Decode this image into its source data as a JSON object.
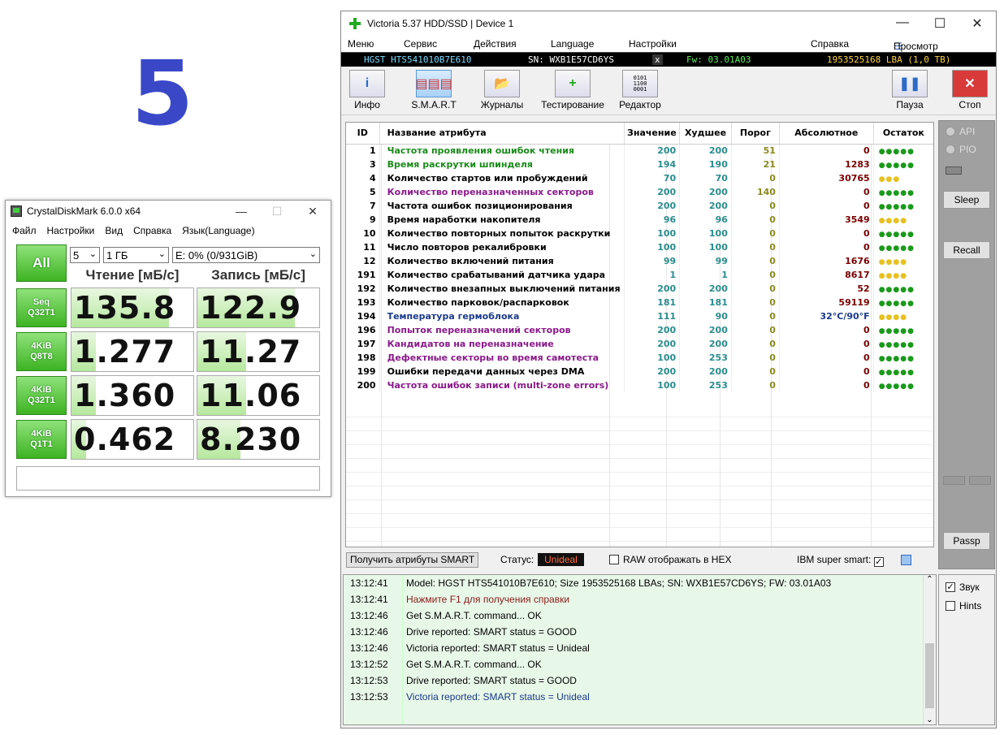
{
  "big_number": "5",
  "cdm": {
    "title": "CrystalDiskMark 6.0.0 x64",
    "menu": [
      "Файл",
      "Настройки",
      "Вид",
      "Справка",
      "Язык(Language)"
    ],
    "all_label": "All",
    "count_value": "5",
    "size_value": "1 ГБ",
    "drive_value": "E: 0% (0/931GiB)",
    "read_header": "Чтение [мБ/с]",
    "write_header": "Запись [мБ/с]",
    "tests": [
      {
        "line1": "Seq",
        "line2": "Q32T1",
        "read": "135.8",
        "write": "122.9",
        "read_fill": 0.8,
        "write_fill": 0.8
      },
      {
        "line1": "4KiB",
        "line2": "Q8T8",
        "read": "1.277",
        "write": "11.27",
        "read_fill": 0.2,
        "write_fill": 0.4
      },
      {
        "line1": "4KiB",
        "line2": "Q32T1",
        "read": "1.360",
        "write": "11.06",
        "read_fill": 0.2,
        "write_fill": 0.4
      },
      {
        "line1": "4KiB",
        "line2": "Q1T1",
        "read": "0.462",
        "write": "8.230",
        "read_fill": 0.12,
        "write_fill": 0.35
      }
    ]
  },
  "victoria": {
    "title": "Victoria 5.37 HDD/SSD | Device 1",
    "menu": {
      "menu": "Меню",
      "service": "Сервис",
      "actions": "Действия",
      "language": "Language",
      "settings": "Настройки",
      "help": "Справка",
      "buffer": "Просмотр буфера"
    },
    "device": {
      "model": "HGST HTS541010B7E610",
      "sn": "SN: WXB1E57CD6YS",
      "x": "x",
      "fw": "Fw: 03.01A03",
      "lba": "1953525168 LBA (1,0 TB)"
    },
    "tools": {
      "info": "Инфо",
      "smart": "S.M.A.R.T",
      "logs": "Журналы",
      "test": "Тестирование",
      "editor": "Редактор",
      "pause": "Пауза",
      "stop": "Стоп"
    },
    "table_headers": {
      "id": "ID",
      "name": "Название атрибута",
      "value": "Значение",
      "worst": "Худшее",
      "threshold": "Порог",
      "absolute": "Абсолютное",
      "remaining": "Остаток"
    },
    "attributes": [
      {
        "id": "1",
        "name": "Частота проявления ошибок чтения",
        "value": "200",
        "worst": "200",
        "thr": "51",
        "abs": "0",
        "color": "#1a8a1a",
        "dots": "green"
      },
      {
        "id": "3",
        "name": "Время раскрутки шпинделя",
        "value": "194",
        "worst": "190",
        "thr": "21",
        "abs": "1283",
        "color": "#1a8a1a",
        "dots": "green"
      },
      {
        "id": "4",
        "name": "Количество стартов или пробуждений",
        "value": "70",
        "worst": "70",
        "thr": "0",
        "abs": "30765",
        "color": "#000000",
        "dots": "yellow"
      },
      {
        "id": "5",
        "name": "Количество переназначенных секторов",
        "value": "200",
        "worst": "200",
        "thr": "140",
        "abs": "0",
        "color": "#8a1a8a",
        "dots": "green"
      },
      {
        "id": "7",
        "name": "Частота ошибок позиционирования",
        "value": "200",
        "worst": "200",
        "thr": "0",
        "abs": "0",
        "color": "#000000",
        "dots": "green"
      },
      {
        "id": "9",
        "name": "Время наработки накопителя",
        "value": "96",
        "worst": "96",
        "thr": "0",
        "abs": "3549",
        "color": "#000000",
        "dots": "yellow"
      },
      {
        "id": "10",
        "name": "Количество повторных попыток раскрутки",
        "value": "100",
        "worst": "100",
        "thr": "0",
        "abs": "0",
        "color": "#000000",
        "dots": "green"
      },
      {
        "id": "11",
        "name": "Число повторов рекалибровки",
        "value": "100",
        "worst": "100",
        "thr": "0",
        "abs": "0",
        "color": "#000000",
        "dots": "green"
      },
      {
        "id": "12",
        "name": "Количество включений питания",
        "value": "99",
        "worst": "99",
        "thr": "0",
        "abs": "1676",
        "color": "#000000",
        "dots": "yellow"
      },
      {
        "id": "191",
        "name": "Количество срабатываний датчика удара",
        "value": "1",
        "worst": "1",
        "thr": "0",
        "abs": "8617",
        "color": "#000000",
        "dots": "yellow"
      },
      {
        "id": "192",
        "name": "Количество внезапных выключений питания",
        "value": "200",
        "worst": "200",
        "thr": "0",
        "abs": "52",
        "color": "#000000",
        "dots": "green"
      },
      {
        "id": "193",
        "name": "Количество парковок/распарковок",
        "value": "181",
        "worst": "181",
        "thr": "0",
        "abs": "59119",
        "color": "#000000",
        "dots": "green"
      },
      {
        "id": "194",
        "name": "Температура гермоблока",
        "value": "111",
        "worst": "90",
        "thr": "0",
        "abs": "32°C/90°F",
        "color": "#1a3a8a",
        "dots": "yellow"
      },
      {
        "id": "196",
        "name": "Попыток переназначений секторов",
        "value": "200",
        "worst": "200",
        "thr": "0",
        "abs": "0",
        "color": "#8a1a8a",
        "dots": "green"
      },
      {
        "id": "197",
        "name": "Кандидатов на переназначение",
        "value": "200",
        "worst": "200",
        "thr": "0",
        "abs": "0",
        "color": "#8a1a8a",
        "dots": "green"
      },
      {
        "id": "198",
        "name": "Дефектные секторы во время самотеста",
        "value": "100",
        "worst": "253",
        "thr": "0",
        "abs": "0",
        "color": "#8a1a8a",
        "dots": "green"
      },
      {
        "id": "199",
        "name": "Ошибки передачи данных через DMA",
        "value": "200",
        "worst": "200",
        "thr": "0",
        "abs": "0",
        "color": "#000000",
        "dots": "green"
      },
      {
        "id": "200",
        "name": "Частота ошибок записи (multi-zone errors)",
        "value": "100",
        "worst": "253",
        "thr": "0",
        "abs": "0",
        "color": "#8a1a8a",
        "dots": "green"
      }
    ],
    "status_bar": {
      "get_smart": "Получить атрибуты SMART",
      "status_label": "Статус:",
      "status_value": "Unideal",
      "raw_hex": "RAW отображать в HEX",
      "ibm": "IBM super smart:"
    },
    "side": {
      "api": "API",
      "pio": "PIO",
      "sleep": "Sleep",
      "recall": "Recall",
      "passp": "Passp",
      "sound": "Звук",
      "hints": "Hints"
    },
    "log": [
      {
        "time": "13:12:41",
        "msg": "Model: HGST HTS541010B7E610; Size 1953525168 LBAs; SN: WXB1E57CD6YS; FW: 03.01A03",
        "color": "#000000"
      },
      {
        "time": "13:12:41",
        "msg": "Нажмите F1 для получения справки",
        "color": "#8a1a1a"
      },
      {
        "time": "13:12:46",
        "msg": "Get S.M.A.R.T. command... OK",
        "color": "#000000"
      },
      {
        "time": "13:12:46",
        "msg": "Drive reported: SMART status = GOOD",
        "color": "#000000"
      },
      {
        "time": "13:12:46",
        "msg": "Victoria reported: SMART status = Unideal",
        "color": "#000000"
      },
      {
        "time": "13:12:52",
        "msg": "Get S.M.A.R.T. command... OK",
        "color": "#000000"
      },
      {
        "time": "13:12:53",
        "msg": "Drive reported: SMART status = GOOD",
        "color": "#000000"
      },
      {
        "time": "13:12:53",
        "msg": "Victoria reported: SMART status = Unideal",
        "color": "#1a3a8a"
      }
    ]
  }
}
